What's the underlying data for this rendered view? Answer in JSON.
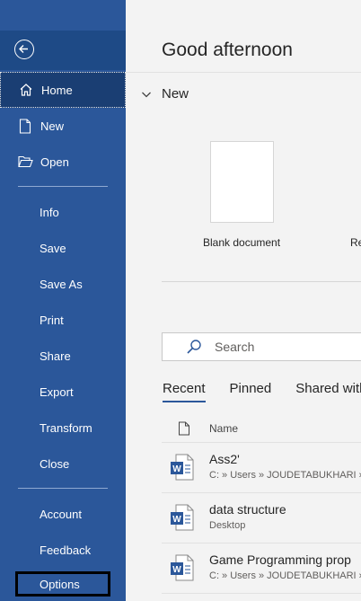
{
  "sidebar": {
    "back_label": "Back",
    "items": [
      {
        "label": "Home"
      },
      {
        "label": "New"
      },
      {
        "label": "Open"
      },
      {
        "label": "Info"
      },
      {
        "label": "Save"
      },
      {
        "label": "Save As"
      },
      {
        "label": "Print"
      },
      {
        "label": "Share"
      },
      {
        "label": "Export"
      },
      {
        "label": "Transform"
      },
      {
        "label": "Close"
      },
      {
        "label": "Account"
      },
      {
        "label": "Feedback"
      },
      {
        "label": "Options"
      }
    ],
    "colors": {
      "background": "#2b579a",
      "active": "#1a3e73"
    }
  },
  "main": {
    "greeting": "Good afternoon",
    "new_section": {
      "title": "New",
      "templates": [
        {
          "label": "Blank document"
        },
        {
          "label": "Re"
        }
      ]
    },
    "search": {
      "placeholder": "Search"
    },
    "tabs": [
      {
        "label": "Recent",
        "active": true
      },
      {
        "label": "Pinned",
        "active": false
      },
      {
        "label": "Shared with",
        "active": false
      }
    ],
    "list": {
      "column_name": "Name",
      "files": [
        {
          "name": "Ass2'",
          "path": "C: » Users » JOUDETABUKHARI »"
        },
        {
          "name": "data structure",
          "path": "Desktop"
        },
        {
          "name": "Game Programming prop",
          "path": "C: » Users » JOUDETABUKHARI »"
        }
      ]
    }
  }
}
